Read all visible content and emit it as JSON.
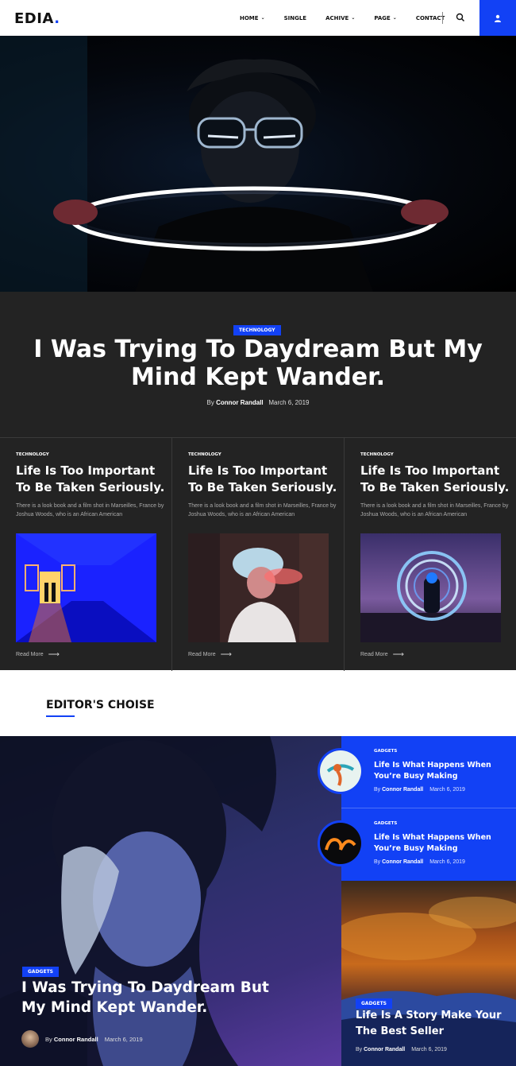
{
  "header": {
    "logo_text": "EDIA",
    "logo_dot": ".",
    "nav": [
      {
        "label": "HOME",
        "dropdown": true
      },
      {
        "label": "SINGLE",
        "dropdown": false
      },
      {
        "label": "ACHIVE",
        "dropdown": true
      },
      {
        "label": "PAGE",
        "dropdown": true
      },
      {
        "label": "CONTACT",
        "dropdown": false
      }
    ],
    "search_icon": "search-icon",
    "user_icon": "user-icon",
    "accent": "#1241f5"
  },
  "hero": {
    "category": "TECHNOLOGY",
    "title": "I Was Trying To Daydream But My Mind Kept Wander.",
    "author_prefix": "By",
    "author": "Connor Randall",
    "date": "March 6, 2019"
  },
  "cards": [
    {
      "category": "TECHNOLOGY",
      "title": "Life Is Too Important To Be Taken Seriously.",
      "excerpt": "There is a look book and a film shot in Marseilles, France by Joshua Woods, who is an African American",
      "read_more": "Read More"
    },
    {
      "category": "TECHNOLOGY",
      "title": "Life Is Too Important To Be Taken Seriously.",
      "excerpt": "There is a look book and a film shot in Marseilles, France by Joshua Woods, who is an African American",
      "read_more": "Read More"
    },
    {
      "category": "TECHNOLOGY",
      "title": "Life Is Too Important To Be Taken Seriously.",
      "excerpt": "There is a look book and a film shot in Marseilles, France by Joshua Woods, who is an African American",
      "read_more": "Read More"
    }
  ],
  "editors_choice": {
    "section_title": "EDITOR'S CHOISE",
    "featured": {
      "category": "GADGETS",
      "title": "I Was Trying To Daydream But My Mind Kept Wander.",
      "author_prefix": "By",
      "author": "Connor Randall",
      "date": "March 6, 2019"
    },
    "side_posts": [
      {
        "category": "GADGETS",
        "title": "Life Is What Happens When You’re Busy Making",
        "author_prefix": "By",
        "author": "Connor Randall",
        "date": "March 6, 2019"
      },
      {
        "category": "GADGETS",
        "title": "Life Is What Happens When You’re Busy Making",
        "author_prefix": "By",
        "author": "Connor Randall",
        "date": "March 6, 2019"
      }
    ],
    "bottom_post": {
      "category": "GADGETS",
      "title": "Life Is A Story Make Your The Best Seller",
      "author_prefix": "By",
      "author": "Connor Randall",
      "date": "March 6, 2019"
    }
  }
}
